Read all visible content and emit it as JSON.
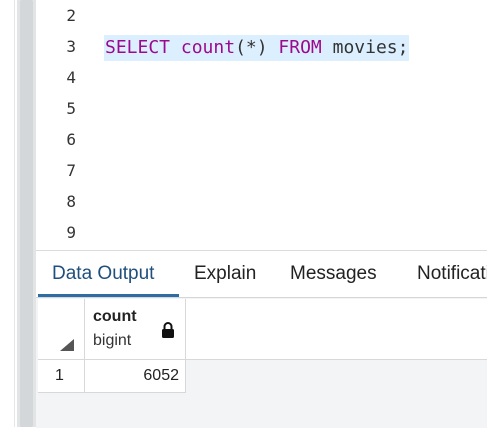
{
  "editor": {
    "line_numbers": [
      "2",
      "3",
      "4",
      "5",
      "6",
      "7",
      "8",
      "9"
    ],
    "query": {
      "kw1": "SELECT",
      "fn": "count",
      "args": "(*)",
      "kw2": "FROM",
      "table": "movies;"
    }
  },
  "panel": {
    "tabs": [
      {
        "label": "Data Output"
      },
      {
        "label": "Explain"
      },
      {
        "label": "Messages"
      },
      {
        "label": "Notifications"
      }
    ],
    "grid": {
      "column": {
        "name": "count",
        "type": "bigint"
      },
      "rows": [
        {
          "row": "1",
          "value": "6052"
        }
      ]
    }
  },
  "colors": {
    "keyword": "#9b0a8e",
    "highlight": "#dcefff",
    "active_tab": "#2d6da3"
  },
  "icons": [
    "lock-icon",
    "sort-corner-icon"
  ]
}
